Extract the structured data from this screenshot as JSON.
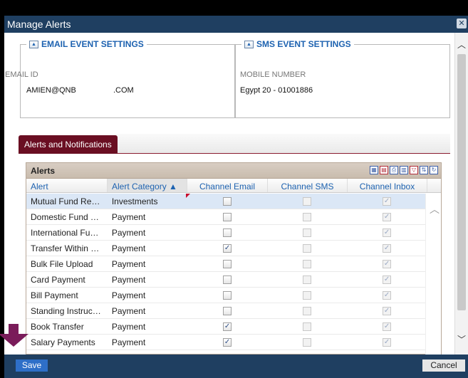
{
  "window": {
    "title": "Manage Alerts",
    "close_label": "✕"
  },
  "email_settings": {
    "legend": "EMAIL EVENT SETTINGS",
    "field_label": "EMAIL ID",
    "value_a": "AMIEN@QNB",
    "value_b": ".COM"
  },
  "sms_settings": {
    "legend": "SMS EVENT SETTINGS",
    "field_label": "MOBILE NUMBER",
    "value": "Egypt 20 - 01001886"
  },
  "tab": {
    "label": "Alerts and Notifications"
  },
  "grid": {
    "title": "Alerts",
    "columns": [
      "Alert",
      "Alert Category ▲",
      "Channel Email",
      "Channel SMS",
      "Channel Inbox"
    ],
    "rows": [
      {
        "alert": "Mutual Fund Requ...",
        "category": "Investments",
        "email": false,
        "sms": false,
        "inbox": true,
        "selected": true
      },
      {
        "alert": "Domestic Fund Tr...",
        "category": "Payment",
        "email": false,
        "sms": false,
        "inbox": true
      },
      {
        "alert": "International Fund...",
        "category": "Payment",
        "email": false,
        "sms": false,
        "inbox": true
      },
      {
        "alert": "Transfer Within Q...",
        "category": "Payment",
        "email": true,
        "sms": false,
        "inbox": true
      },
      {
        "alert": "Bulk File Upload",
        "category": "Payment",
        "email": false,
        "sms": false,
        "inbox": true
      },
      {
        "alert": "Card Payment",
        "category": "Payment",
        "email": false,
        "sms": false,
        "inbox": true
      },
      {
        "alert": "Bill Payment",
        "category": "Payment",
        "email": false,
        "sms": false,
        "inbox": true
      },
      {
        "alert": "Standing Instruction",
        "category": "Payment",
        "email": false,
        "sms": false,
        "inbox": true
      },
      {
        "alert": "Book Transfer",
        "category": "Payment",
        "email": true,
        "sms": false,
        "inbox": true
      },
      {
        "alert": "Salary Payments",
        "category": "Payment",
        "email": true,
        "sms": false,
        "inbox": true
      }
    ]
  },
  "footer": {
    "save_label": "Save",
    "cancel_label": "Cancel"
  },
  "colors": {
    "titlebar": "#1f3f61",
    "tab": "#6a0e22",
    "accent_link": "#1d62b0",
    "save": "#2e6fc8",
    "annotation_arrow": "#7a1c5a"
  }
}
